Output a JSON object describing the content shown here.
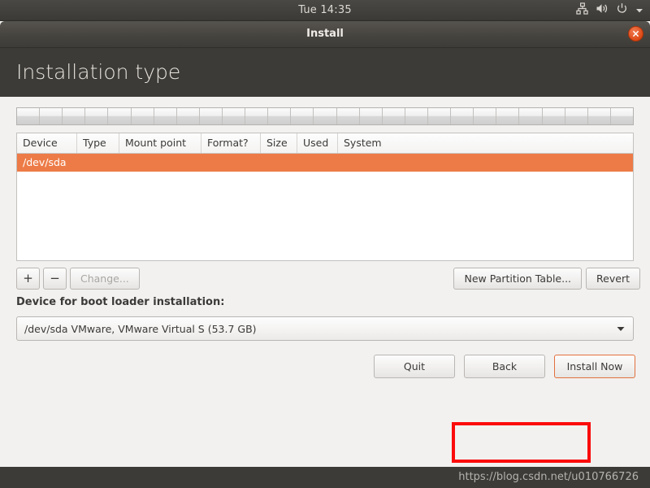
{
  "top_panel": {
    "clock": "Tue 14:35",
    "indicators": [
      {
        "name": "network-icon",
        "label": "network"
      },
      {
        "name": "volume-icon",
        "label": "volume"
      },
      {
        "name": "power-icon",
        "label": "power"
      },
      {
        "name": "chevron-down-icon",
        "label": "session menu"
      }
    ]
  },
  "window": {
    "title": "Install",
    "close_label": "x"
  },
  "page": {
    "title": "Installation type"
  },
  "partition_bar": {
    "segment_count": 27
  },
  "table": {
    "columns": [
      "Device",
      "Type",
      "Mount point",
      "Format?",
      "Size",
      "Used",
      "System"
    ],
    "rows": [
      {
        "device": "/dev/sda",
        "type": "",
        "mount_point": "",
        "format": "",
        "size": "",
        "used": "",
        "system": "",
        "selected": true
      }
    ]
  },
  "toolbar": {
    "add_label": "+",
    "remove_label": "−",
    "change_label": "Change...",
    "new_partition_table_label": "New Partition Table...",
    "revert_label": "Revert"
  },
  "bootloader": {
    "label": "Device for boot loader installation:",
    "value": "/dev/sda VMware, VMware Virtual S (53.7 GB)"
  },
  "actions": {
    "quit_label": "Quit",
    "back_label": "Back",
    "install_label": "Install Now"
  },
  "footer": {
    "watermark": "https://blog.csdn.net/u010766726"
  },
  "colors": {
    "selection_orange": "#ed7b47",
    "header_dark": "#3c3b37",
    "content_background": "#f2f1f0",
    "annotation_red": "#fb0b0b",
    "close_button_orange": "#dd4814"
  }
}
